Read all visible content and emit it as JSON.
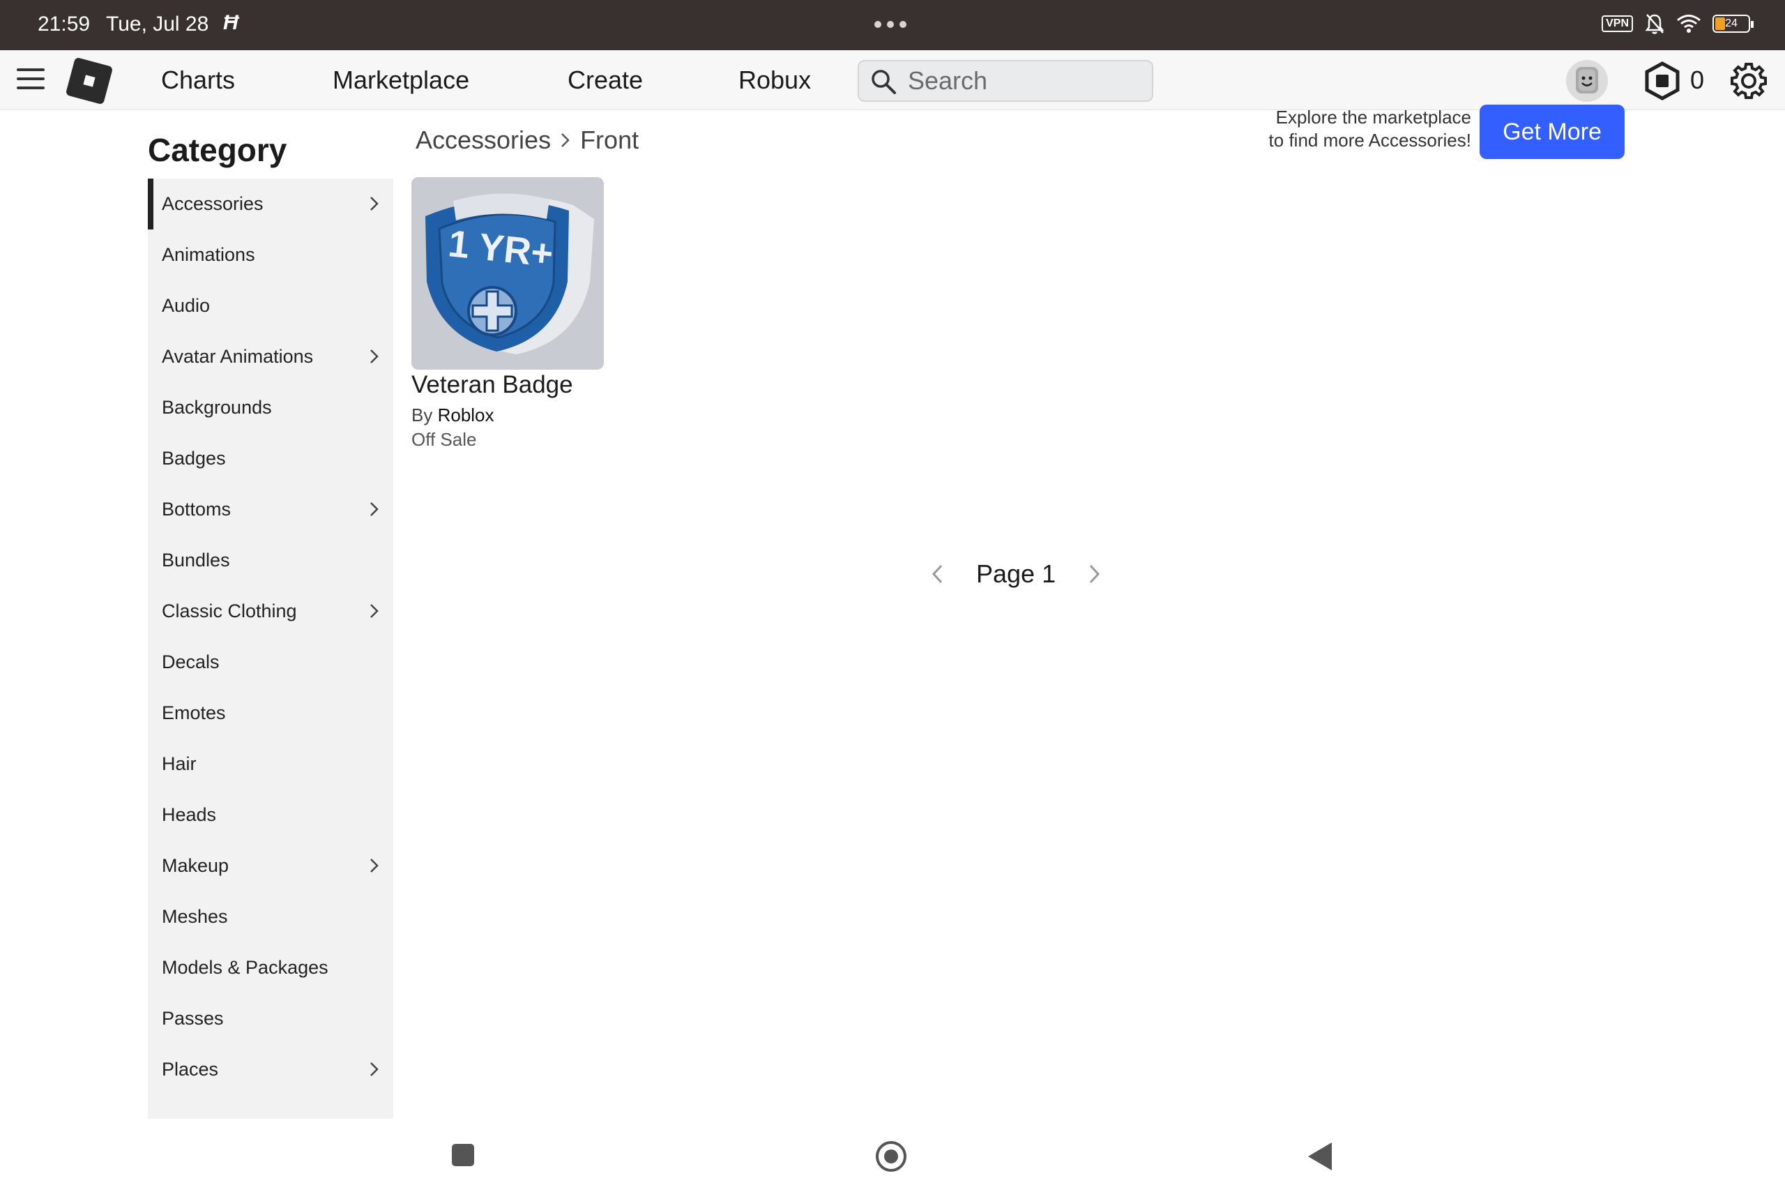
{
  "status_bar": {
    "time": "21:59",
    "date": "Tue, Jul 28",
    "app_glyph": "Ħ",
    "vpn": "VPN",
    "battery": "24"
  },
  "nav": {
    "links": [
      "Charts",
      "Marketplace",
      "Create",
      "Robux"
    ],
    "search_placeholder": "Search",
    "robux_count": "0"
  },
  "sidebar": {
    "title": "Category",
    "items": [
      {
        "label": "Accessories",
        "has_children": true,
        "active": true
      },
      {
        "label": "Animations",
        "has_children": false
      },
      {
        "label": "Audio",
        "has_children": false
      },
      {
        "label": "Avatar Animations",
        "has_children": true
      },
      {
        "label": "Backgrounds",
        "has_children": false
      },
      {
        "label": "Badges",
        "has_children": false
      },
      {
        "label": "Bottoms",
        "has_children": true
      },
      {
        "label": "Bundles",
        "has_children": false
      },
      {
        "label": "Classic Clothing",
        "has_children": true
      },
      {
        "label": "Decals",
        "has_children": false
      },
      {
        "label": "Emotes",
        "has_children": false
      },
      {
        "label": "Hair",
        "has_children": false
      },
      {
        "label": "Heads",
        "has_children": false
      },
      {
        "label": "Makeup",
        "has_children": true
      },
      {
        "label": "Meshes",
        "has_children": false
      },
      {
        "label": "Models & Packages",
        "has_children": false
      },
      {
        "label": "Passes",
        "has_children": false
      },
      {
        "label": "Places",
        "has_children": true
      }
    ]
  },
  "breadcrumb": {
    "parent": "Accessories",
    "current": "Front"
  },
  "promo": {
    "line1": "Explore the marketplace",
    "line2": "to find more Accessories!",
    "button": "Get More"
  },
  "item": {
    "thumbnail_text": "1 YR+",
    "name": "Veteran Badge",
    "by_label": "By",
    "creator": "Roblox",
    "price": "Off Sale"
  },
  "pager": {
    "label": "Page 1"
  },
  "colors": {
    "status_bar": "#393130",
    "accent_button": "#335fff",
    "badge_blue": "#1f5fa8"
  }
}
